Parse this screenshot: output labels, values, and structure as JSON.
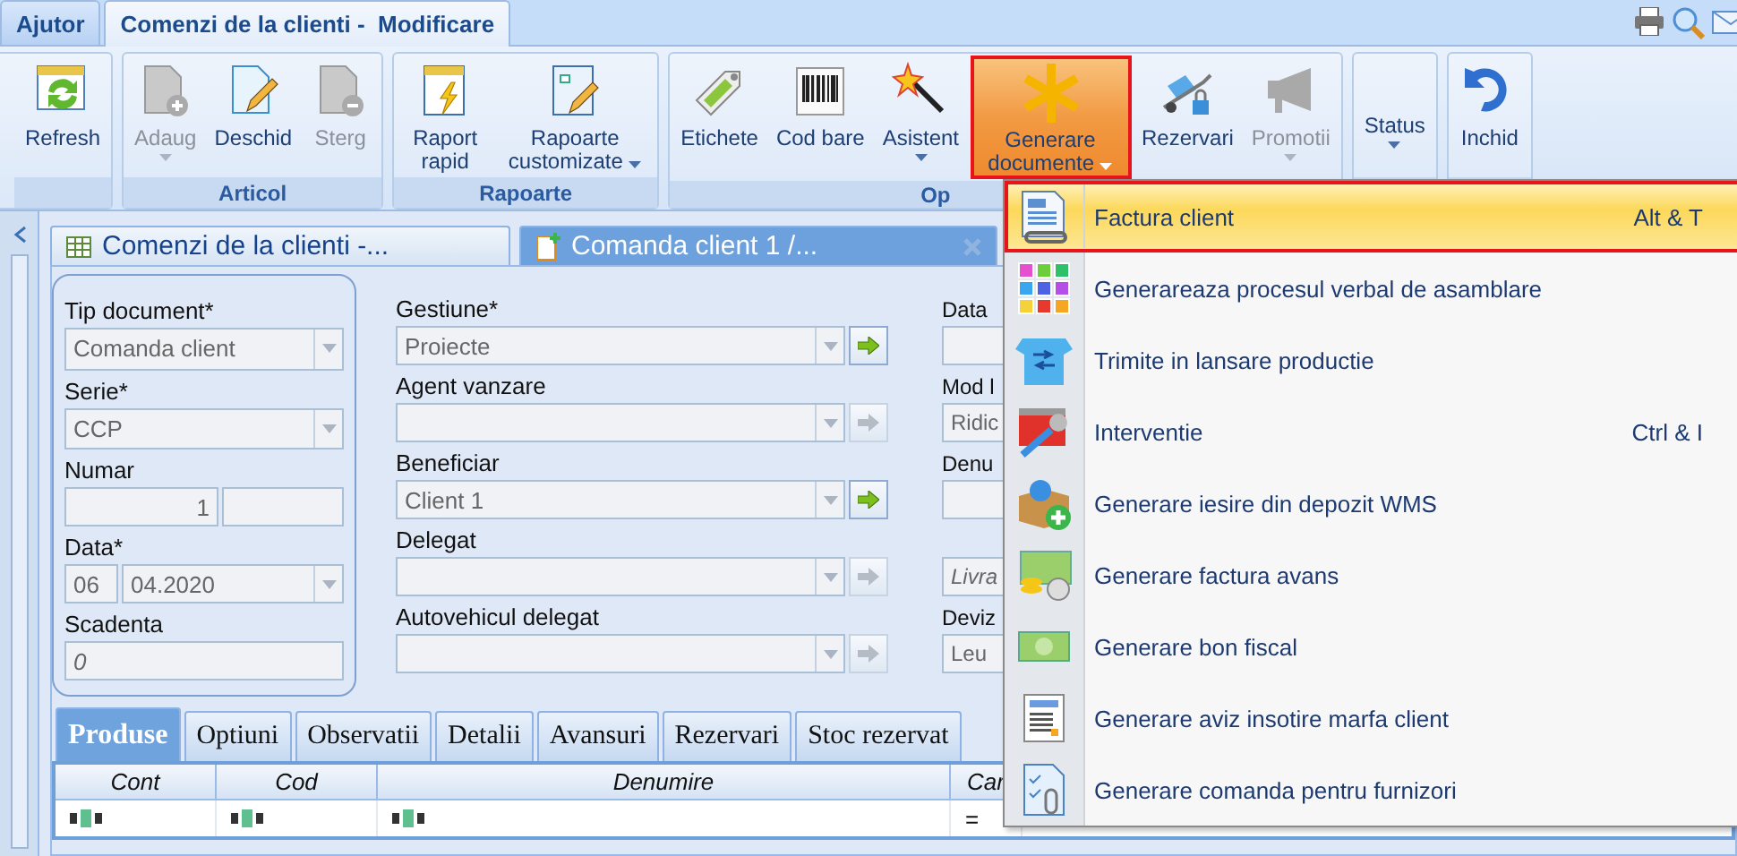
{
  "top_tabs": [
    {
      "label": "Ajutor",
      "selected": false
    },
    {
      "label": "Comenzi de la clienti -  Modificare",
      "selected": true
    }
  ],
  "ribbon": {
    "groups": [
      {
        "buttons": [
          {
            "label": "Refresh",
            "disabled": false,
            "dropdown": false,
            "pressed": false
          }
        ]
      },
      {
        "label": "Articol",
        "buttons": [
          {
            "label": "Adaug",
            "disabled": true,
            "dropdown": true,
            "pressed": false
          },
          {
            "label": "Deschid",
            "disabled": false,
            "dropdown": false,
            "pressed": false
          },
          {
            "label": "Sterg",
            "disabled": true,
            "dropdown": false,
            "pressed": false
          }
        ]
      },
      {
        "label": "Rapoarte",
        "buttons": [
          {
            "label": "Raport rapid",
            "disabled": false,
            "dropdown": false,
            "pressed": false
          },
          {
            "label": "Rapoarte customizate",
            "disabled": false,
            "dropdown": true,
            "pressed": false
          }
        ]
      },
      {
        "label": "Op",
        "buttons": [
          {
            "label": "Etichete",
            "disabled": false,
            "dropdown": false,
            "pressed": false
          },
          {
            "label": "Cod bare",
            "disabled": false,
            "dropdown": false,
            "pressed": false
          },
          {
            "label": "Asistent",
            "disabled": false,
            "dropdown": true,
            "pressed": false
          },
          {
            "label": "Generare documente",
            "disabled": false,
            "dropdown": true,
            "pressed": true
          },
          {
            "label": "Rezervari",
            "disabled": false,
            "dropdown": false,
            "pressed": false
          },
          {
            "label": "Promotii",
            "disabled": true,
            "dropdown": true,
            "pressed": false
          }
        ]
      },
      {
        "buttons": [
          {
            "label": "Status",
            "disabled": false,
            "dropdown": true,
            "pressed": false
          }
        ]
      },
      {
        "buttons": [
          {
            "label": "Inchid",
            "disabled": false,
            "dropdown": false,
            "pressed": false
          }
        ]
      }
    ]
  },
  "doc_tabs": [
    {
      "label": "Comenzi de la clienti -...",
      "selected": false
    },
    {
      "label": "Comanda client 1 /...",
      "selected": true
    }
  ],
  "form": {
    "left_fields": [
      {
        "kind": "select",
        "label": "Tip document*",
        "value": "Comanda client"
      },
      {
        "kind": "select",
        "label": "Serie*",
        "value": "CCP"
      },
      {
        "kind": "pair",
        "label": "Numar",
        "value": "1"
      },
      {
        "kind": "date",
        "label": "Data*",
        "day": "06",
        "value": "04.2020"
      },
      {
        "kind": "text",
        "label": "Scadenta",
        "placeholder": "0"
      }
    ],
    "middle_fields": [
      {
        "label": "Gestiune*",
        "value": "Proiecte",
        "link_enabled": true
      },
      {
        "label": "Agent vanzare",
        "link_enabled": false
      },
      {
        "label": "Beneficiar",
        "value": "Client 1",
        "link_enabled": true
      },
      {
        "label": "Delegat",
        "link_enabled": false
      },
      {
        "label": "Autovehicul delegat",
        "link_enabled": false
      }
    ],
    "right_fields": [
      {
        "label": "Data"
      },
      {
        "label": "Mod l",
        "value": "Ridic"
      },
      {
        "label": "Denu"
      },
      {
        "placeholder": "Livra"
      },
      {
        "label": "Deviz",
        "value": "Leu"
      }
    ]
  },
  "detail_tabs": [
    {
      "label": "Produse",
      "selected": true
    },
    {
      "label": "Optiuni",
      "selected": false
    },
    {
      "label": "Observatii",
      "selected": false
    },
    {
      "label": "Detalii",
      "selected": false
    },
    {
      "label": "Avansuri",
      "selected": false
    },
    {
      "label": "Rezervari",
      "selected": false
    },
    {
      "label": "Stoc rezervat",
      "selected": false
    }
  ],
  "grid": {
    "columns": [
      "Cont",
      "Cod",
      "Denumire",
      "Car"
    ],
    "filter_row": [
      {
        "kind": "text"
      },
      {
        "kind": "text"
      },
      {
        "kind": "text"
      },
      {
        "kind": "number",
        "symbol": "="
      }
    ]
  },
  "menu": {
    "items": [
      {
        "label": "Factura client",
        "shortcut": "Alt & T",
        "selected": true
      },
      {
        "label": "Generareaza procesul verbal de asamblare",
        "selected": false
      },
      {
        "label": "Trimite in lansare productie",
        "selected": false
      },
      {
        "label": "Interventie",
        "shortcut": "Ctrl & I",
        "selected": false
      },
      {
        "label": "Generare iesire din depozit WMS",
        "selected": false
      },
      {
        "label": "Generare factura avans",
        "selected": false
      },
      {
        "label": "Generare bon fiscal",
        "selected": false
      },
      {
        "label": "Generare aviz insotire marfa client",
        "selected": false
      },
      {
        "label": "Generare comanda pentru furnizori",
        "selected": false
      }
    ]
  }
}
